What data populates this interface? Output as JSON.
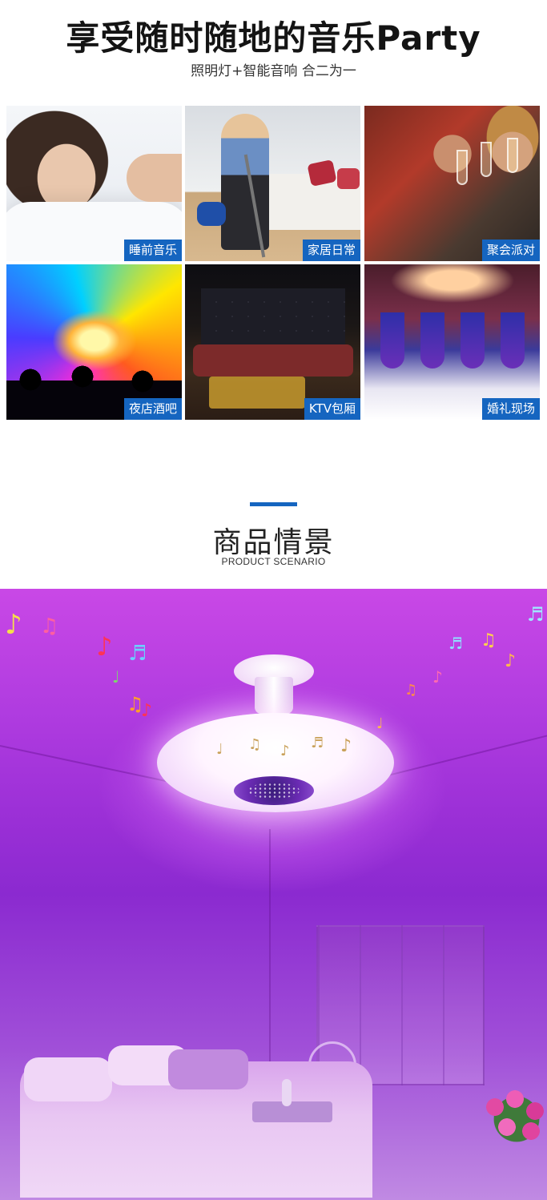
{
  "hero": {
    "title": "享受随时随地的音乐Party",
    "subtitle": "照明灯+智能音响 合二为一"
  },
  "scenes": [
    {
      "label": "睡前音乐",
      "icon": "sleeping-woman-photo"
    },
    {
      "label": "家居日常",
      "icon": "vacuum-cleaning-photo"
    },
    {
      "label": "聚会派对",
      "icon": "party-toast-photo"
    },
    {
      "label": "夜店酒吧",
      "icon": "nightclub-lights-photo"
    },
    {
      "label": "KTV包厢",
      "icon": "ktv-room-photo"
    },
    {
      "label": "婚礼现场",
      "icon": "wedding-hall-photo"
    }
  ],
  "section": {
    "title": "商品情景",
    "subtitle": "PRODUCT SCENARIO"
  },
  "product_scene": {
    "icon": "bluetooth-speaker-ceiling-light-photo",
    "glow_color": "#b03ce0",
    "label_color": "#1565c0",
    "notes": [
      "♪",
      "♫",
      "♩",
      "♬"
    ]
  }
}
